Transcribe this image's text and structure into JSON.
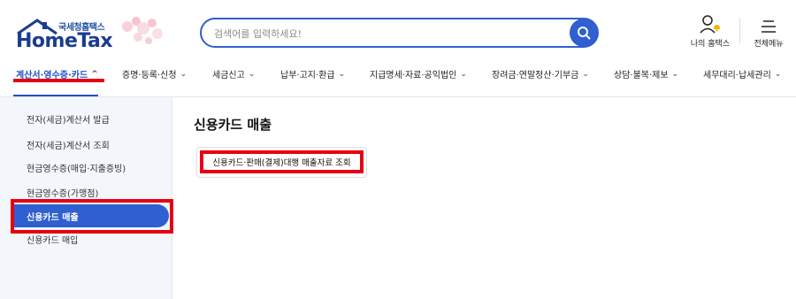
{
  "header": {
    "logo_sub": "국세청홈택스",
    "logo_main": "HomeTax",
    "search_placeholder": "검색어를 입력하세요!",
    "my_hometax_label": "나의 홈택스",
    "all_menu_label": "전체메뉴"
  },
  "nav": {
    "items": [
      {
        "label": "계산서·영수증·카드"
      },
      {
        "label": "증명·등록·신청"
      },
      {
        "label": "세금신고"
      },
      {
        "label": "납부·고지·환급"
      },
      {
        "label": "지급명세·자료·공익법인"
      },
      {
        "label": "장려금·연말정산·기부금"
      },
      {
        "label": "상담·불복·제보"
      },
      {
        "label": "세무대리·납세관리"
      }
    ]
  },
  "sidebar": {
    "items": [
      {
        "label": "전자(세금)계산서 발급"
      },
      {
        "label": "전자(세금)계산서 조회"
      },
      {
        "label": "현금영수증(매입·지출증빙)"
      },
      {
        "label": "현금영수증(가맹점)"
      },
      {
        "label": "신용카드 매출"
      },
      {
        "label": "신용카드 매입"
      }
    ]
  },
  "main": {
    "title": "신용카드 매출",
    "submenu_button": "신용카드·판매(결제)대행 매출자료 조회"
  },
  "colors": {
    "primary": "#2f5fd0",
    "highlight_red": "#e60012",
    "sidebar_bg": "#f3f6fb"
  }
}
